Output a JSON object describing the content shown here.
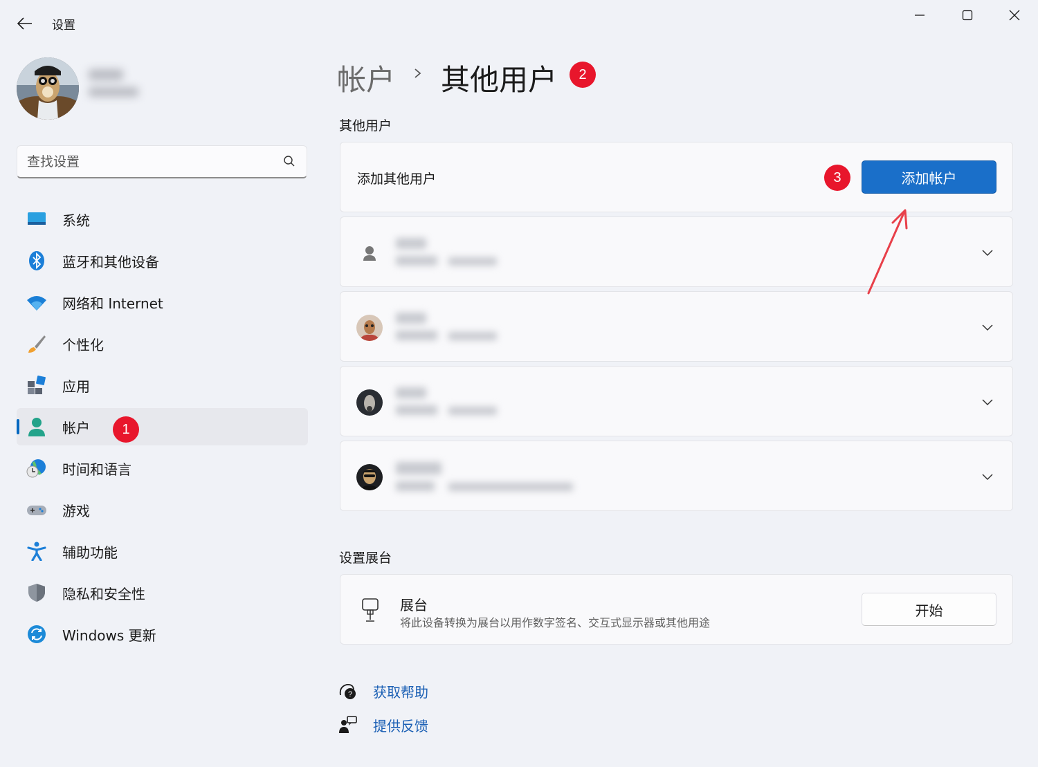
{
  "window": {
    "title": "设置",
    "controls": [
      "minimize",
      "maximize",
      "close"
    ]
  },
  "search": {
    "placeholder": "查找设置"
  },
  "sidebar": {
    "items": [
      {
        "label": "系统",
        "icon": "system-icon"
      },
      {
        "label": "蓝牙和其他设备",
        "icon": "bluetooth-icon"
      },
      {
        "label": "网络和 Internet",
        "icon": "wifi-icon"
      },
      {
        "label": "个性化",
        "icon": "brush-icon"
      },
      {
        "label": "应用",
        "icon": "apps-icon"
      },
      {
        "label": "帐户",
        "icon": "account-icon",
        "active": true
      },
      {
        "label": "时间和语言",
        "icon": "globe-clock-icon"
      },
      {
        "label": "游戏",
        "icon": "gamepad-icon"
      },
      {
        "label": "辅助功能",
        "icon": "accessibility-icon"
      },
      {
        "label": "隐私和安全性",
        "icon": "shield-icon"
      },
      {
        "label": "Windows 更新",
        "icon": "update-icon"
      }
    ]
  },
  "annotations": {
    "badge1": "1",
    "badge2": "2",
    "badge3": "3"
  },
  "breadcrumb": {
    "parent": "帐户",
    "separator": "›",
    "current": "其他用户"
  },
  "other_users": {
    "section_title": "其他用户",
    "add_row_label": "添加其他用户",
    "add_button": "添加帐户",
    "users": [
      {
        "avatar": "default-person-icon"
      },
      {
        "avatar": "photo"
      },
      {
        "avatar": "photo"
      },
      {
        "avatar": "photo"
      }
    ]
  },
  "kiosk": {
    "section_title": "设置展台",
    "title": "展台",
    "description": "将此设备转换为展台以用作数字签名、交互式显示器或其他用途",
    "button": "开始"
  },
  "links": {
    "help": "获取帮助",
    "feedback": "提供反馈"
  },
  "colors": {
    "accent": "#1a6fc9",
    "badge": "#e8162c",
    "link": "#1a5fb4",
    "arrow": "#e8404a"
  }
}
